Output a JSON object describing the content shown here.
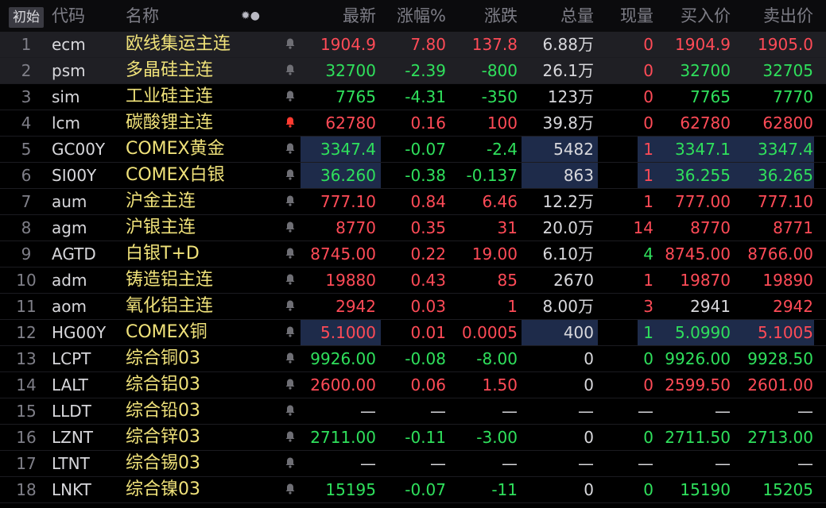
{
  "toolbar": {
    "init_label": "初始"
  },
  "columns": {
    "code": "代码",
    "name": "名称",
    "last": "最新",
    "pct": "涨幅%",
    "chg": "涨跌",
    "vol": "总量",
    "cur": "现量",
    "bid": "买入价",
    "ask": "卖出价",
    "header_icons": "✹●"
  },
  "colors": {
    "up": "#ff4b57",
    "down": "#2fe05c",
    "neutral": "#d8d8dc",
    "name": "#f0e27a"
  },
  "rows": [
    {
      "idx": "1",
      "code": "ecm",
      "name": "欧线集运主连",
      "alert": false,
      "last": "1904.9",
      "pct": "7.80",
      "chg": "137.8",
      "vol": "6.88万",
      "cur": "0",
      "bid": "1904.9",
      "ask": "1905.0",
      "last_dir": "up",
      "pct_dir": "up",
      "chg_dir": "up",
      "bid_dir": "up",
      "ask_dir": "up",
      "cur_dir": "up",
      "selected": true
    },
    {
      "idx": "2",
      "code": "psm",
      "name": "多晶硅主连",
      "alert": false,
      "last": "32700",
      "pct": "-2.39",
      "chg": "-800",
      "vol": "26.1万",
      "cur": "0",
      "bid": "32700",
      "ask": "32705",
      "last_dir": "down",
      "pct_dir": "down",
      "chg_dir": "down",
      "bid_dir": "down",
      "ask_dir": "down",
      "cur_dir": "up",
      "selected": true
    },
    {
      "idx": "3",
      "code": "sim",
      "name": "工业硅主连",
      "alert": false,
      "last": "7765",
      "pct": "-4.31",
      "chg": "-350",
      "vol": "123万",
      "cur": "0",
      "bid": "7765",
      "ask": "7770",
      "last_dir": "down",
      "pct_dir": "down",
      "chg_dir": "down",
      "bid_dir": "down",
      "ask_dir": "down",
      "cur_dir": "up"
    },
    {
      "idx": "4",
      "code": "lcm",
      "name": "碳酸锂主连",
      "alert": true,
      "last": "62780",
      "pct": "0.16",
      "chg": "100",
      "vol": "39.8万",
      "cur": "0",
      "bid": "62780",
      "ask": "62800",
      "last_dir": "up",
      "pct_dir": "up",
      "chg_dir": "up",
      "bid_dir": "up",
      "ask_dir": "up",
      "cur_dir": "up"
    },
    {
      "idx": "5",
      "code": "GC00Y",
      "name": "COMEX黄金",
      "alert": false,
      "last": "3347.4",
      "pct": "-0.07",
      "chg": "-2.4",
      "vol": "5482",
      "cur": "1",
      "bid": "3347.1",
      "ask": "3347.4",
      "last_dir": "down",
      "pct_dir": "down",
      "chg_dir": "down",
      "bid_dir": "down",
      "ask_dir": "down",
      "cur_dir": "up",
      "highlight": true
    },
    {
      "idx": "6",
      "code": "SI00Y",
      "name": "COMEX白银",
      "alert": false,
      "last": "36.260",
      "pct": "-0.38",
      "chg": "-0.137",
      "vol": "863",
      "cur": "1",
      "bid": "36.255",
      "ask": "36.265",
      "last_dir": "down",
      "pct_dir": "down",
      "chg_dir": "down",
      "bid_dir": "down",
      "ask_dir": "down",
      "cur_dir": "up",
      "highlight": true
    },
    {
      "idx": "7",
      "code": "aum",
      "name": "沪金主连",
      "alert": false,
      "last": "777.10",
      "pct": "0.84",
      "chg": "6.46",
      "vol": "12.2万",
      "cur": "1",
      "bid": "777.00",
      "ask": "777.10",
      "last_dir": "up",
      "pct_dir": "up",
      "chg_dir": "up",
      "bid_dir": "up",
      "ask_dir": "up",
      "cur_dir": "up"
    },
    {
      "idx": "8",
      "code": "agm",
      "name": "沪银主连",
      "alert": false,
      "last": "8770",
      "pct": "0.35",
      "chg": "31",
      "vol": "20.0万",
      "cur": "14",
      "bid": "8770",
      "ask": "8771",
      "last_dir": "up",
      "pct_dir": "up",
      "chg_dir": "up",
      "bid_dir": "up",
      "ask_dir": "up",
      "cur_dir": "up"
    },
    {
      "idx": "9",
      "code": "AGTD",
      "name": "白银T+D",
      "alert": false,
      "last": "8745.00",
      "pct": "0.22",
      "chg": "19.00",
      "vol": "6.10万",
      "cur": "4",
      "bid": "8745.00",
      "ask": "8766.00",
      "last_dir": "up",
      "pct_dir": "up",
      "chg_dir": "up",
      "bid_dir": "up",
      "ask_dir": "up",
      "cur_dir": "down"
    },
    {
      "idx": "10",
      "code": "adm",
      "name": "铸造铝主连",
      "alert": false,
      "last": "19880",
      "pct": "0.43",
      "chg": "85",
      "vol": "2670",
      "cur": "1",
      "bid": "19870",
      "ask": "19890",
      "last_dir": "up",
      "pct_dir": "up",
      "chg_dir": "up",
      "bid_dir": "up",
      "ask_dir": "up",
      "cur_dir": "up"
    },
    {
      "idx": "11",
      "code": "aom",
      "name": "氧化铝主连",
      "alert": false,
      "last": "2942",
      "pct": "0.03",
      "chg": "1",
      "vol": "8.00万",
      "cur": "3",
      "bid": "2941",
      "ask": "2942",
      "last_dir": "up",
      "pct_dir": "up",
      "chg_dir": "up",
      "bid_dir": "neutral",
      "ask_dir": "up",
      "cur_dir": "up"
    },
    {
      "idx": "12",
      "code": "HG00Y",
      "name": "COMEX铜",
      "alert": false,
      "last": "5.1000",
      "pct": "0.01",
      "chg": "0.0005",
      "vol": "400",
      "cur": "1",
      "bid": "5.0990",
      "ask": "5.1005",
      "last_dir": "up",
      "pct_dir": "up",
      "chg_dir": "up",
      "bid_dir": "down",
      "ask_dir": "up",
      "cur_dir": "down",
      "highlight": true
    },
    {
      "idx": "13",
      "code": "LCPT",
      "name": "综合铜03",
      "alert": false,
      "last": "9926.00",
      "pct": "-0.08",
      "chg": "-8.00",
      "vol": "0",
      "cur": "0",
      "bid": "9926.00",
      "ask": "9928.50",
      "last_dir": "down",
      "pct_dir": "down",
      "chg_dir": "down",
      "bid_dir": "down",
      "ask_dir": "down",
      "cur_dir": "down"
    },
    {
      "idx": "14",
      "code": "LALT",
      "name": "综合铝03",
      "alert": false,
      "last": "2600.00",
      "pct": "0.06",
      "chg": "1.50",
      "vol": "0",
      "cur": "0",
      "bid": "2599.50",
      "ask": "2601.00",
      "last_dir": "up",
      "pct_dir": "up",
      "chg_dir": "up",
      "bid_dir": "up",
      "ask_dir": "up",
      "cur_dir": "up"
    },
    {
      "idx": "15",
      "code": "LLDT",
      "name": "综合铅03",
      "alert": false,
      "last": "—",
      "pct": "—",
      "chg": "—",
      "vol": "—",
      "cur": "—",
      "bid": "—",
      "ask": "—",
      "last_dir": "neutral",
      "pct_dir": "neutral",
      "chg_dir": "neutral",
      "bid_dir": "neutral",
      "ask_dir": "neutral",
      "cur_dir": "neutral"
    },
    {
      "idx": "16",
      "code": "LZNT",
      "name": "综合锌03",
      "alert": false,
      "last": "2711.00",
      "pct": "-0.11",
      "chg": "-3.00",
      "vol": "0",
      "cur": "0",
      "bid": "2711.50",
      "ask": "2713.00",
      "last_dir": "down",
      "pct_dir": "down",
      "chg_dir": "down",
      "bid_dir": "down",
      "ask_dir": "down",
      "cur_dir": "down"
    },
    {
      "idx": "17",
      "code": "LTNT",
      "name": "综合锡03",
      "alert": false,
      "last": "—",
      "pct": "—",
      "chg": "—",
      "vol": "—",
      "cur": "—",
      "bid": "—",
      "ask": "—",
      "last_dir": "neutral",
      "pct_dir": "neutral",
      "chg_dir": "neutral",
      "bid_dir": "neutral",
      "ask_dir": "neutral",
      "cur_dir": "neutral"
    },
    {
      "idx": "18",
      "code": "LNKT",
      "name": "综合镍03",
      "alert": false,
      "last": "15195",
      "pct": "-0.07",
      "chg": "-11",
      "vol": "0",
      "cur": "0",
      "bid": "15190",
      "ask": "15205",
      "last_dir": "down",
      "pct_dir": "down",
      "chg_dir": "down",
      "bid_dir": "down",
      "ask_dir": "down",
      "cur_dir": "down"
    }
  ]
}
